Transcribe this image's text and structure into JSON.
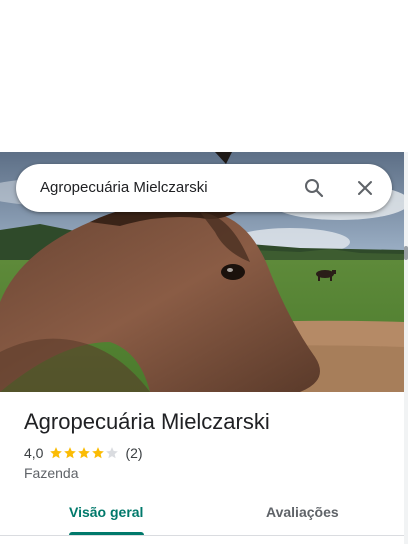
{
  "search": {
    "query": "Agropecuária Mielczarski",
    "search_icon": "search-icon",
    "close_icon": "close-icon"
  },
  "place": {
    "name": "Agropecuária Mielczarski",
    "rating": "4,0",
    "rating_value": 4.0,
    "rating_max": 5,
    "review_count": "(2)",
    "category": "Fazenda"
  },
  "tabs": [
    {
      "label": "Visão geral",
      "active": true
    },
    {
      "label": "Avaliações",
      "active": false
    }
  ],
  "colors": {
    "accent": "#00796b",
    "star_filled": "#fbbc04",
    "star_empty": "#dadce0"
  }
}
